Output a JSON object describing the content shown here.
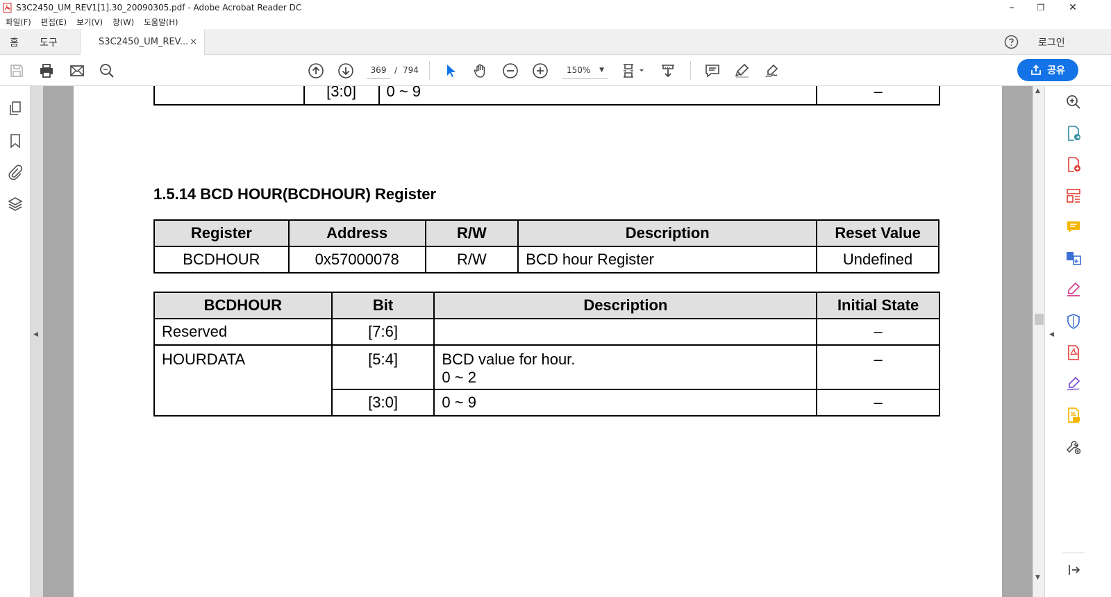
{
  "window": {
    "title": "S3C2450_UM_REV1[1].30_20090305.pdf - Adobe Acrobat Reader DC",
    "minimize": "–",
    "restore": "❐",
    "close": "✕"
  },
  "menu": [
    "파일(F)",
    "편집(E)",
    "보기(V)",
    "창(W)",
    "도움말(H)"
  ],
  "tabs": {
    "home": "홈",
    "tools": "도구",
    "document": "S3C2450_UM_REV...",
    "close": "×",
    "login": "로그인"
  },
  "toolbar": {
    "page_current": "369",
    "page_sep": "/",
    "page_total": "794",
    "zoom": "150%",
    "share_label": "공유"
  },
  "icons": {
    "accent": "#1473e6",
    "left_panel": [
      "pages-icon",
      "bookmark-icon",
      "attachment-icon",
      "layers-icon"
    ],
    "right_panel": [
      "zoom-search-icon",
      "export-pdf-icon",
      "create-pdf-icon",
      "organize-pages-icon",
      "comment-icon",
      "combine-files-icon",
      "fill-sign-icon",
      "protect-icon",
      "compress-pdf-icon",
      "request-signature-icon",
      "send-comments-icon",
      "more-tools-icon",
      "collapse-panel-icon"
    ]
  },
  "document": {
    "prev_table_row": {
      "bit": "[3:0]",
      "description": "0 ~ 9",
      "state": "–"
    },
    "section_title": "1.5.14 BCD HOUR(BCDHOUR) Register",
    "register_table": {
      "headers": [
        "Register",
        "Address",
        "R/W",
        "Description",
        "Reset Value"
      ],
      "row": [
        "BCDHOUR",
        "0x57000078",
        "R/W",
        "BCD hour Register",
        "Undefined"
      ]
    },
    "bit_table": {
      "headers": [
        "BCDHOUR",
        "Bit",
        "Description",
        "Initial State"
      ],
      "rows": [
        {
          "name": "Reserved",
          "bit": "[7:6]",
          "description": "",
          "state": "–"
        },
        {
          "name": "HOURDATA",
          "bit": "[5:4]",
          "description": "BCD value for hour.",
          "description2": "0 ~ 2",
          "state": "–"
        },
        {
          "name": "",
          "bit": "[3:0]",
          "description": "0 ~ 9",
          "state": "–"
        }
      ]
    }
  }
}
